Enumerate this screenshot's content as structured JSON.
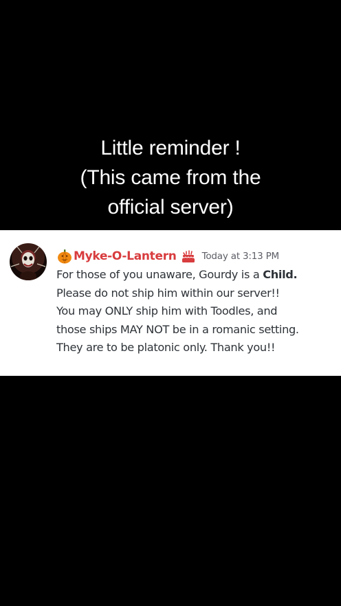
{
  "caption": {
    "lines": [
      "Little reminder !",
      "(This came from the",
      "official server)"
    ]
  },
  "message": {
    "author": "Myke-O-Lantern",
    "author_color": "#d83c3e",
    "author_prefix_icon": "pumpkin-icon",
    "role_icon": "cake-icon",
    "timestamp": "Today at 3:13 PM",
    "lines": [
      {
        "pre": "For those of you unaware, Gourdy is a ",
        "bold": "Child."
      },
      {
        "text": "Please do not ship him within our server!!"
      },
      {
        "text": "You may ONLY ship him with Toodles, and"
      },
      {
        "text": "those ships MAY NOT be in a romanic setting."
      },
      {
        "text": "They are to be platonic only. Thank you!!"
      }
    ]
  },
  "colors": {
    "background": "#000000",
    "panel": "#ffffff",
    "text": "#2e3338",
    "muted": "#5c5e66"
  }
}
